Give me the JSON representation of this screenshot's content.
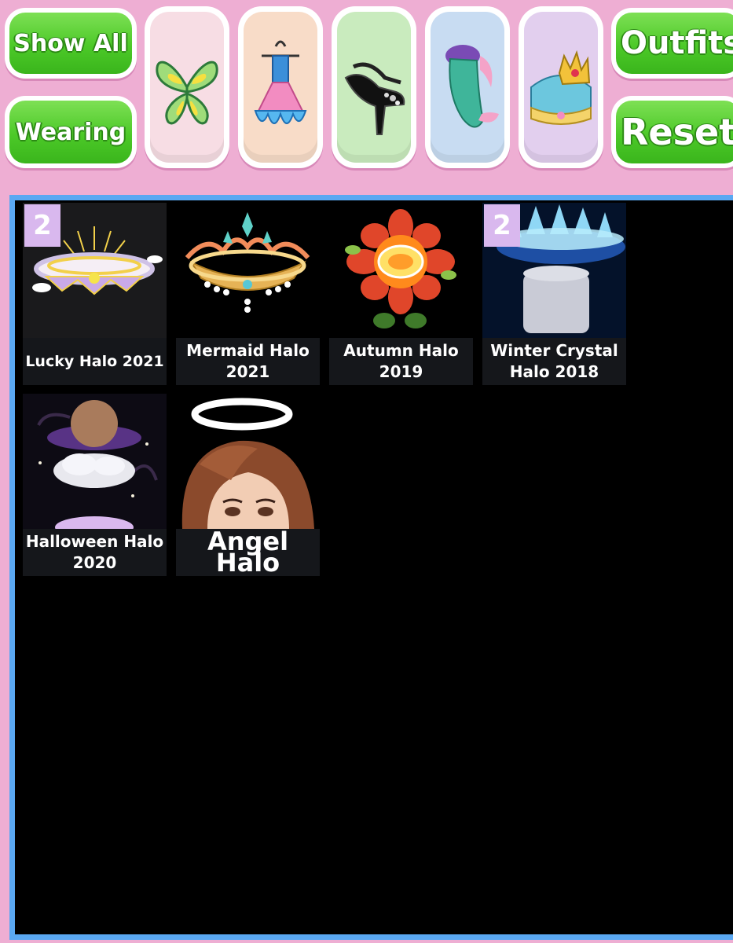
{
  "toolbar": {
    "show_all_label": "Show All",
    "wearing_label": "Wearing",
    "outfits_label": "Outfits",
    "reset_label": "Reset",
    "categories": [
      {
        "icon": "wings-icon",
        "bg": "#f7dde4"
      },
      {
        "icon": "dress-icon",
        "bg": "#f8dcc8"
      },
      {
        "icon": "high-heels-icon",
        "bg": "#c9ebbe"
      },
      {
        "icon": "mermaid-tail-icon",
        "bg": "#c8dcf2"
      },
      {
        "icon": "crown-icon",
        "bg": "#e2cfee"
      }
    ]
  },
  "inventory": {
    "items": [
      {
        "name": "Lucky Halo 2021",
        "count": "2",
        "icon": "lucky-halo-icon"
      },
      {
        "name": "Mermaid Halo 2021",
        "count": "",
        "icon": "mermaid-halo-icon"
      },
      {
        "name": "Autumn Halo 2019",
        "count": "",
        "icon": "autumn-halo-icon"
      },
      {
        "name": "Winter Crystal Halo 2018",
        "count": "2",
        "icon": "winter-crystal-halo-icon"
      },
      {
        "name": "Halloween Halo 2020",
        "count": "",
        "icon": "halloween-halo-icon"
      },
      {
        "name": "Angel Halo",
        "count": "",
        "icon": "angel-halo-icon"
      }
    ]
  },
  "colors": {
    "background": "#eeaed3",
    "button_green": "#4cc928",
    "panel_border": "#5aa8f2",
    "badge": "#d9b8ee"
  }
}
